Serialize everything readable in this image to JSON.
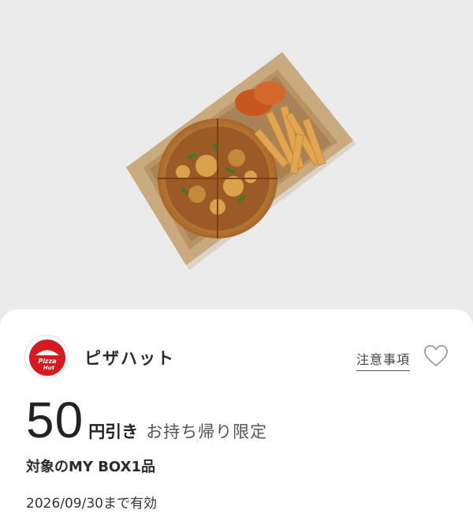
{
  "hero": {
    "image_description_icon": "pizza-box-icon"
  },
  "shop": {
    "logo_text": "Pizza Hut",
    "name": "ピザハット",
    "notes_label": "注意事項",
    "favorite_icon": "heart-icon",
    "brand_color": "#d71920"
  },
  "coupon": {
    "amount": "50",
    "unit": "円引き",
    "condition": "お持ち帰り限定",
    "target": "対象のMY BOX1品",
    "expiry": "2026/09/30まで有効"
  }
}
